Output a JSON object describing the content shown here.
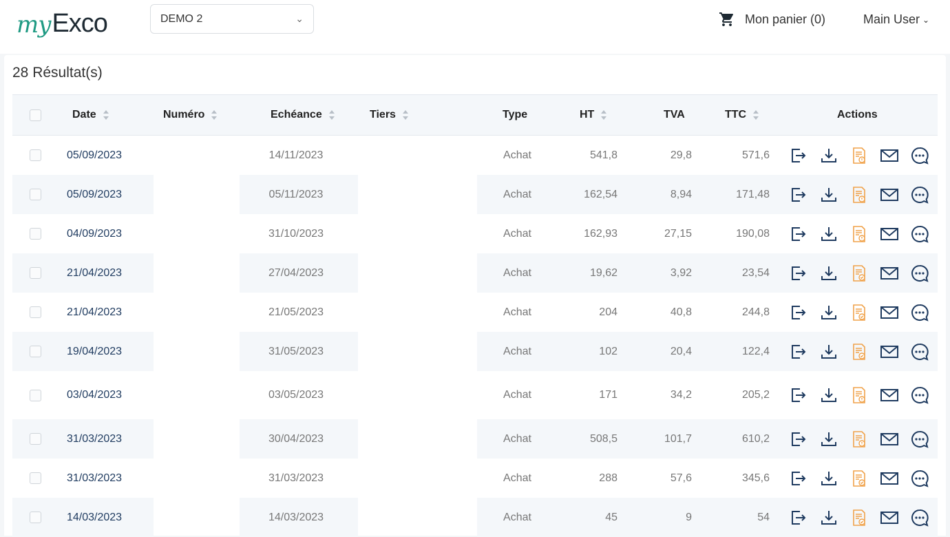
{
  "header": {
    "logo_my": "my",
    "logo_ex": "Exco",
    "company": "DEMO 2",
    "cart_label": "Mon panier (0)",
    "user_label": "Main User"
  },
  "results_label": "28 Résultat(s)",
  "columns": {
    "date": "Date",
    "numero": "Numéro",
    "echeance": "Echéance",
    "tiers": "Tiers",
    "type": "Type",
    "ht": "HT",
    "tva": "TVA",
    "ttc": "TTC",
    "actions": "Actions"
  },
  "rows": [
    {
      "date": "05/09/2023",
      "echeance": "14/11/2023",
      "type": "Achat",
      "ht": "541,8",
      "tva": "29,8",
      "ttc": "571,6",
      "status": "alert"
    },
    {
      "date": "05/09/2023",
      "echeance": "05/11/2023",
      "type": "Achat",
      "ht": "162,54",
      "tva": "8,94",
      "ttc": "171,48",
      "status": "alert"
    },
    {
      "date": "04/09/2023",
      "echeance": "31/10/2023",
      "type": "Achat",
      "ht": "162,93",
      "tva": "27,15",
      "ttc": "190,08",
      "status": "alert"
    },
    {
      "date": "21/04/2023",
      "echeance": "27/04/2023",
      "type": "Achat",
      "ht": "19,62",
      "tva": "3,92",
      "ttc": "23,54",
      "status": "check"
    },
    {
      "date": "21/04/2023",
      "echeance": "21/05/2023",
      "type": "Achat",
      "ht": "204",
      "tva": "40,8",
      "ttc": "244,8",
      "status": "check"
    },
    {
      "date": "19/04/2023",
      "echeance": "31/05/2023",
      "type": "Achat",
      "ht": "102",
      "tva": "20,4",
      "ttc": "122,4",
      "status": "check"
    },
    {
      "date": "03/04/2023",
      "echeance": "03/05/2023",
      "type": "Achat",
      "ht": "171",
      "tva": "34,2",
      "ttc": "205,2",
      "status": "alert"
    },
    {
      "date": "31/03/2023",
      "echeance": "30/04/2023",
      "type": "Achat",
      "ht": "508,5",
      "tva": "101,7",
      "ttc": "610,2",
      "status": "alert"
    },
    {
      "date": "31/03/2023",
      "echeance": "31/03/2023",
      "type": "Achat",
      "ht": "288",
      "tva": "57,6",
      "ttc": "345,6",
      "status": "check"
    },
    {
      "date": "14/03/2023",
      "echeance": "14/03/2023",
      "type": "Achat",
      "ht": "45",
      "tva": "9",
      "ttc": "54",
      "status": "check"
    }
  ],
  "colors": {
    "accent_dark": "#1e3a5f",
    "doc_orange": "#f0a24a",
    "logo_teal": "#1f9a83",
    "stripe": "#f4f7fa"
  }
}
